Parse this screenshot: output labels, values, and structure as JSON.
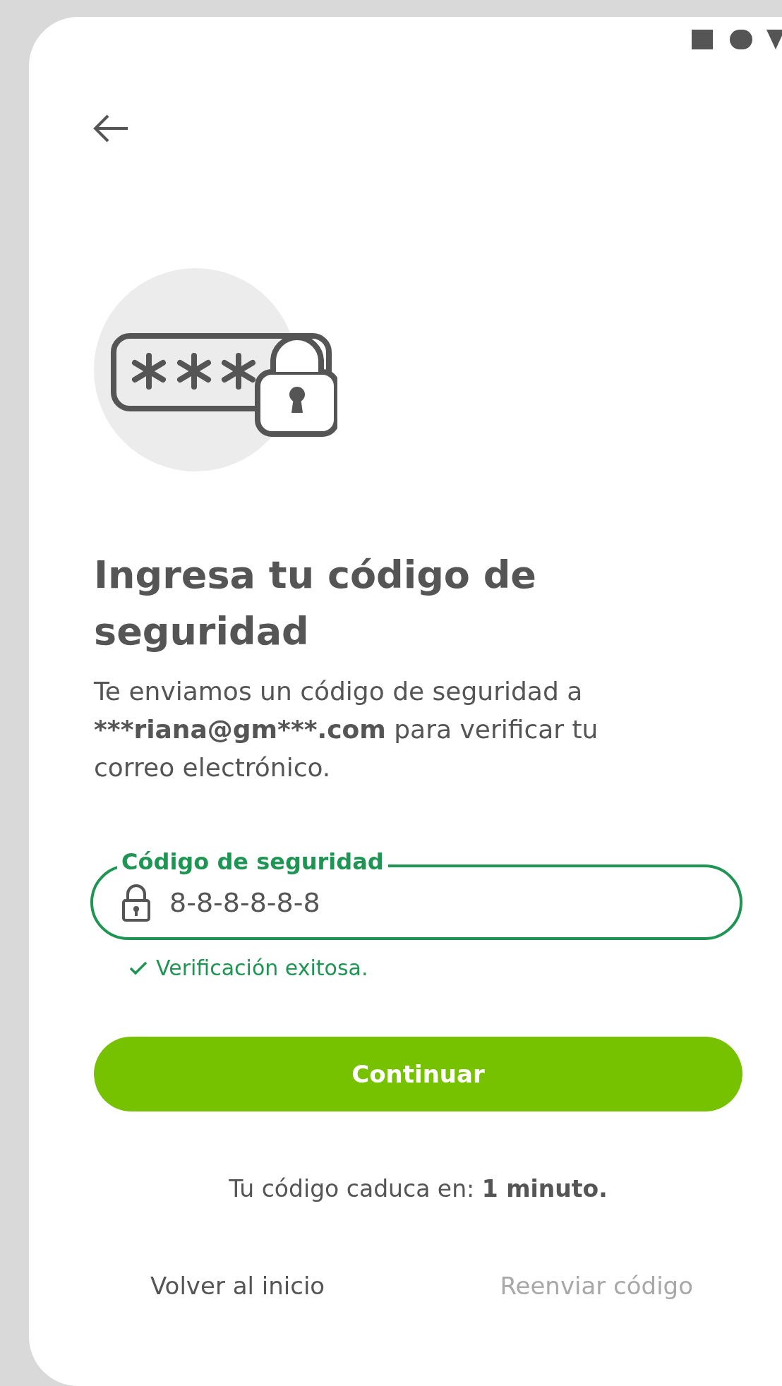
{
  "title": "Ingresa tu código de seguridad",
  "description": {
    "before": "Te enviamos un código de seguridad a ",
    "email": "***riana@gm***.com",
    "after": " para verificar tu correo electrónico."
  },
  "code_field": {
    "label": "Código de seguridad",
    "value": "8-8-8-8-8-8",
    "valid": true,
    "message": "Verificación exitosa."
  },
  "continue_button": {
    "label": "Continuar",
    "disabled": false
  },
  "expiry": {
    "label": "Tu código caduca en: ",
    "value": "1 minuto."
  },
  "links": [
    {
      "label": "Volver al inicio",
      "disabled": false
    },
    {
      "label": "Reenviar código",
      "disabled": true
    }
  ]
}
